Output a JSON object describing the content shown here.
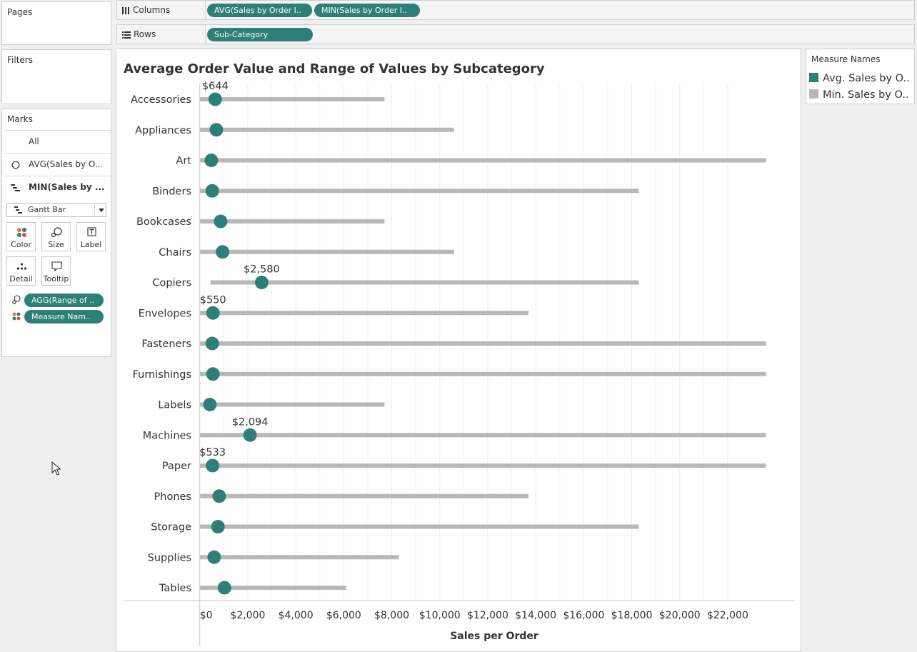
{
  "pages": {
    "title": "Pages"
  },
  "filters": {
    "title": "Filters"
  },
  "columns_shelf": {
    "label": "Columns",
    "pills": [
      "AVG(Sales by Order I..",
      "MIN(Sales by Order I.."
    ]
  },
  "rows_shelf": {
    "label": "Rows",
    "pills": [
      "Sub-Category"
    ]
  },
  "marks": {
    "title": "Marks",
    "cards": [
      "All",
      "AVG(Sales by O...",
      "MIN(Sales by ..."
    ],
    "mark_type": "Gantt Bar",
    "buttons": [
      "Color",
      "Size",
      "Label",
      "Detail",
      "Tooltip"
    ],
    "fields": [
      "AGG(Range of ..",
      "Measure Nam.."
    ]
  },
  "legend": {
    "title": "Measure Names",
    "items": [
      {
        "label": "Avg. Sales by O..",
        "color": "#2e7f77"
      },
      {
        "label": "Min. Sales by O..",
        "color": "#b8b8b8"
      }
    ]
  },
  "chart_data": {
    "type": "scatter",
    "title": "Average Order Value and Range of Values by Subcategory",
    "xlabel": "Sales per Order",
    "ylabel": "",
    "xlim": [
      -200,
      24800
    ],
    "x_ticks": [
      0,
      2000,
      4000,
      6000,
      8000,
      10000,
      12000,
      14000,
      16000,
      18000,
      20000,
      22000
    ],
    "x_tick_labels": [
      "$0",
      "$2,000",
      "$4,000",
      "$6,000",
      "$8,000",
      "$10,000",
      "$12,000",
      "$14,000",
      "$16,000",
      "$18,000",
      "$20,000",
      "$22,000"
    ],
    "grid": true,
    "legend_position": "right",
    "categories": [
      "Accessories",
      "Appliances",
      "Art",
      "Binders",
      "Bookcases",
      "Chairs",
      "Copiers",
      "Envelopes",
      "Fasteners",
      "Furnishings",
      "Labels",
      "Machines",
      "Paper",
      "Phones",
      "Storage",
      "Supplies",
      "Tables"
    ],
    "series": [
      {
        "name": "Avg. Sales by O..",
        "color": "#2e7f77",
        "values": [
          644,
          690,
          480,
          520,
          870,
          950,
          2580,
          550,
          520,
          550,
          420,
          2094,
          533,
          810,
          760,
          600,
          1030
        ],
        "labels": [
          "$644",
          "",
          "",
          "",
          "",
          "",
          "$2,580",
          "$550",
          "",
          "",
          "",
          "$2,094",
          "$533",
          "",
          "",
          "",
          ""
        ]
      },
      {
        "name": "Min. Sales by O..",
        "color": "#b8b8b8",
        "ranges": [
          [
            0,
            7700
          ],
          [
            0,
            10600
          ],
          [
            0,
            23600
          ],
          [
            0,
            18300
          ],
          [
            0,
            7700
          ],
          [
            0,
            10600
          ],
          [
            450,
            18300
          ],
          [
            0,
            13700
          ],
          [
            0,
            23600
          ],
          [
            0,
            23600
          ],
          [
            0,
            7700
          ],
          [
            0,
            23600
          ],
          [
            0,
            23600
          ],
          [
            0,
            13700
          ],
          [
            0,
            18300
          ],
          [
            0,
            8300
          ],
          [
            0,
            6100
          ]
        ]
      }
    ]
  }
}
